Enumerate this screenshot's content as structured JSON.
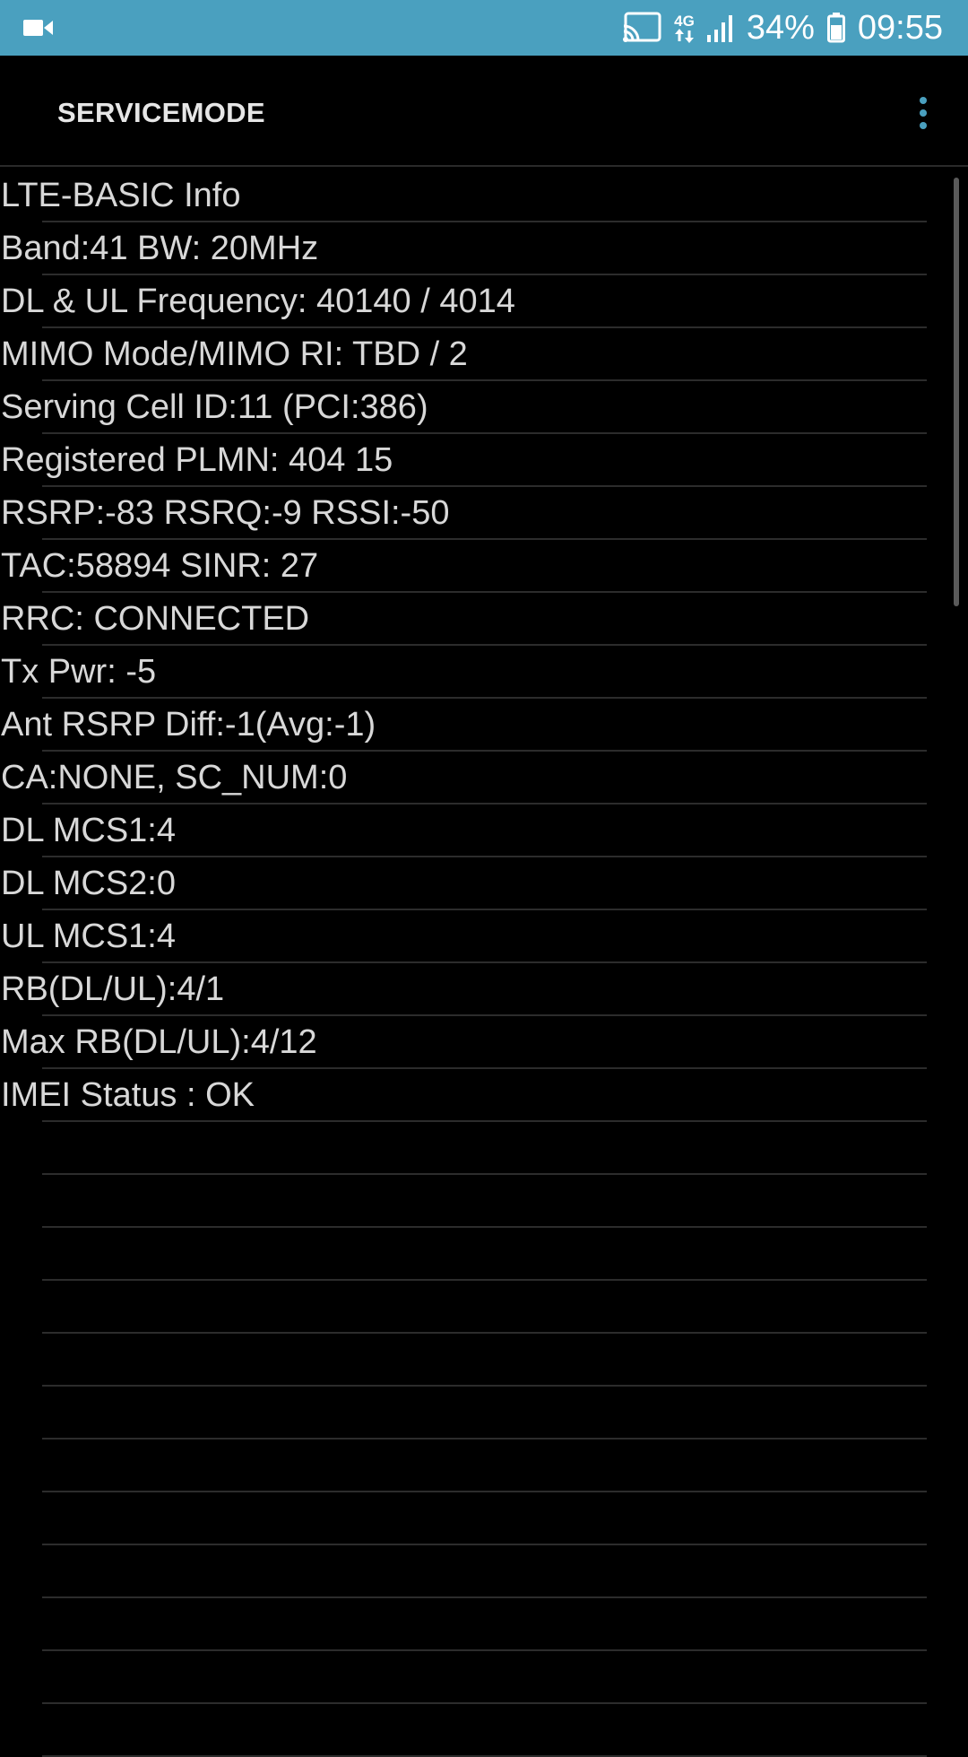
{
  "status_bar": {
    "left_icon": "video-call-icon",
    "cast_icon": "cast-icon",
    "network_type": "4G",
    "signal_icon": "signal-icon",
    "battery_percent": "34%",
    "battery_icon": "battery-icon",
    "time": "09:55"
  },
  "app_bar": {
    "title": "SERVICEMODE",
    "menu_icon": "more-vert-icon"
  },
  "rows": [
    "LTE-BASIC Info",
    "Band:41 BW: 20MHz",
    "DL & UL Frequency: 40140 / 4014",
    "MIMO Mode/MIMO RI: TBD / 2",
    "Serving Cell ID:11 (PCI:386)",
    "Registered PLMN: 404 15",
    "RSRP:-83 RSRQ:-9 RSSI:-50",
    "TAC:58894 SINR: 27",
    "RRC: CONNECTED",
    "Tx Pwr: -5",
    "Ant RSRP Diff:-1(Avg:-1)",
    "CA:NONE, SC_NUM:0",
    "DL MCS1:4",
    "DL MCS2:0",
    "UL MCS1:4",
    "RB(DL/UL):4/1",
    "Max RB(DL/UL):4/12",
    "IMEI Status : OK",
    "",
    "",
    "",
    "",
    "",
    "",
    "",
    "",
    "",
    "",
    "",
    ""
  ],
  "colors": {
    "status_bar_bg": "#4aa0bf",
    "background": "#000000",
    "text": "#d8d8d8",
    "divider": "#2c2c2c",
    "accent": "#4aa0bf"
  }
}
